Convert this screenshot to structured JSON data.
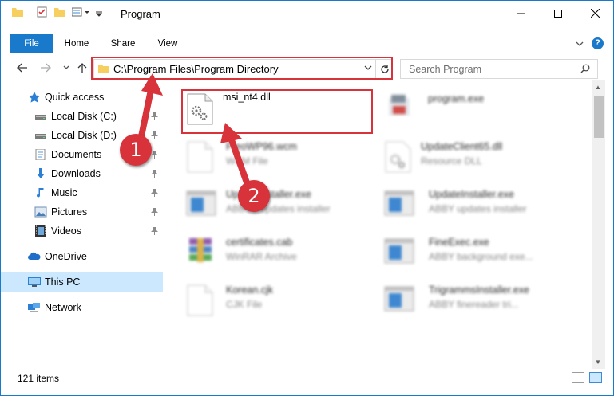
{
  "window": {
    "title": "Program"
  },
  "ribbon": {
    "tabs": [
      "File",
      "Home",
      "Share",
      "View"
    ],
    "help_label": "?"
  },
  "address_bar": {
    "path": "C:\\Program Files\\Program Directory"
  },
  "search": {
    "placeholder": "Search Program"
  },
  "sidebar": {
    "items": [
      {
        "label": "Quick access",
        "icon": "star-icon"
      },
      {
        "label": "Local Disk (C:)",
        "icon": "drive-icon",
        "pinned": true
      },
      {
        "label": "Local Disk (D:)",
        "icon": "drive-icon",
        "pinned": true
      },
      {
        "label": "Documents",
        "icon": "documents-icon",
        "pinned": true
      },
      {
        "label": "Downloads",
        "icon": "download-icon",
        "pinned": true
      },
      {
        "label": "Music",
        "icon": "music-icon",
        "pinned": true
      },
      {
        "label": "Pictures",
        "icon": "pictures-icon",
        "pinned": true
      },
      {
        "label": "Videos",
        "icon": "videos-icon",
        "pinned": true
      },
      {
        "label": "OneDrive",
        "icon": "cloud-icon"
      },
      {
        "label": "This PC",
        "icon": "monitor-icon",
        "selected": true
      },
      {
        "label": "Network",
        "icon": "network-icon"
      }
    ]
  },
  "files": [
    {
      "name": "msi_nt4.dll",
      "type": "",
      "icon": "dll-icon"
    },
    {
      "name": "program.exe",
      "type": "",
      "icon": "app-icon"
    },
    {
      "name": "FreoWP96.wcm",
      "type": "WCM File",
      "icon": "file-icon"
    },
    {
      "name": "UpdateClient65.dll",
      "type": "Resource DLL",
      "icon": "dll-icon"
    },
    {
      "name": "UpdateInstaller.exe",
      "type": "ABBYY updates installer",
      "icon": "installer-icon"
    },
    {
      "name": "UpdateInstaller.exe",
      "type": "ABBY updates installer",
      "icon": "installer-icon"
    },
    {
      "name": "certificates.cab",
      "type": "WinRAR Archive",
      "icon": "archive-icon"
    },
    {
      "name": "FineExec.exe",
      "type": "ABBY background exe...",
      "icon": "installer-icon"
    },
    {
      "name": "Korean.cjk",
      "type": "CJK File",
      "icon": "file-icon"
    },
    {
      "name": "TrigrammsInstaller.exe",
      "type": "ABBY finereader tri...",
      "icon": "installer-icon"
    }
  ],
  "status": {
    "item_count": "121 items"
  },
  "annotations": {
    "step1": "1",
    "step2": "2"
  },
  "colors": {
    "accent": "#1979ca",
    "highlight": "#d8333a",
    "selected_bg": "#cce8ff"
  }
}
